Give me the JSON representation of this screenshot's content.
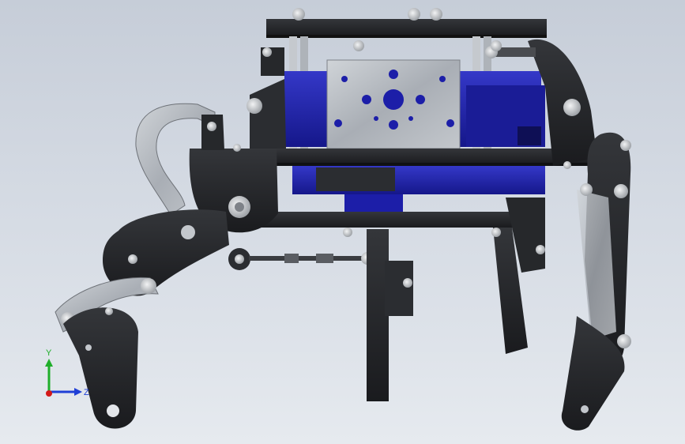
{
  "axis_triad": {
    "y_label": "Y",
    "z_label": "Z",
    "colors": {
      "y_axis": "#1fae2a",
      "z_axis": "#1f3fd6",
      "x_axis": "#d41818"
    }
  },
  "colors": {
    "background_top": "#c6cdd8",
    "background_bottom": "#e6eaef",
    "frame_black": "#1e1f22",
    "frame_dark": "#2b2d31",
    "servo_blue": "#1c1ea8",
    "servo_blue_light": "#3236c9",
    "bracket_silver": "#b9bec4",
    "bracket_silver_dark": "#8b9097",
    "screw_silver": "#d8dadc"
  }
}
